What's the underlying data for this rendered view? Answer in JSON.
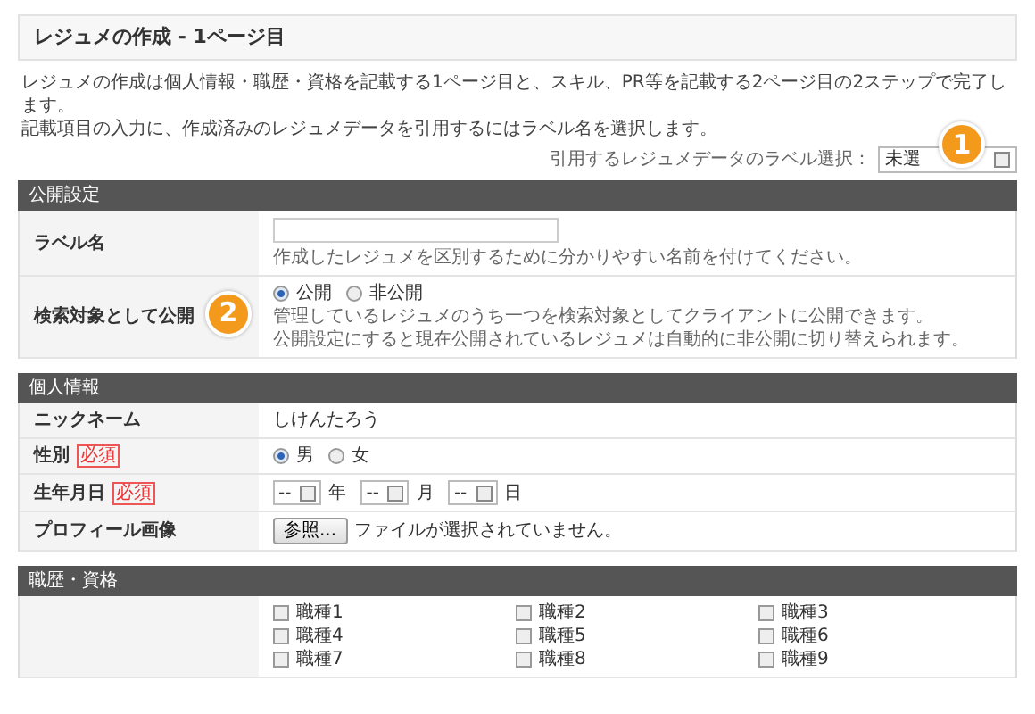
{
  "page_title": "レジュメの作成 - 1ページ目",
  "intro": [
    "レジュメの作成は個人情報・職歴・資格を記載する1ページ目と、スキル、PR等を記載する2ページ目の2ステップで完了します。",
    "記載項目の入力に、作成済みのレジュメデータを引用するにはラベル名を選択します。"
  ],
  "label_select": {
    "label": "引用するレジュメデータのラベル選択：",
    "value": "未選",
    "callout": "1"
  },
  "sections": [
    {
      "title": "公開設定",
      "rows": [
        {
          "kind": "text_input",
          "label": "ラベル名",
          "hint": "作成したレジュメを区別するために分かりやすい名前を付けてください。"
        },
        {
          "kind": "radio",
          "label": "検索対象として公開",
          "callout": "2",
          "options": [
            {
              "label": "公開",
              "selected": true
            },
            {
              "label": "非公開",
              "selected": false
            }
          ],
          "notes": [
            "管理しているレジュメのうち一つを検索対象としてクライアントに公開できます。",
            "公開設定にすると現在公開されているレジュメは自動的に非公開に切り替えられます。"
          ]
        }
      ]
    },
    {
      "title": "個人情報",
      "rows": [
        {
          "kind": "text",
          "label": "ニックネーム",
          "value": "しけんたろう"
        },
        {
          "kind": "radio",
          "label": "性別",
          "required_label": "必須",
          "options": [
            {
              "label": "男",
              "selected": true
            },
            {
              "label": "女",
              "selected": false
            }
          ]
        },
        {
          "kind": "date",
          "label": "生年月日",
          "required_label": "必須",
          "parts": [
            {
              "value": "--",
              "unit": "年"
            },
            {
              "value": "--",
              "unit": "月"
            },
            {
              "value": "--",
              "unit": "日"
            }
          ]
        },
        {
          "kind": "file",
          "label": "プロフィール画像",
          "button": "参照...",
          "status": "ファイルが選択されていません。"
        }
      ]
    },
    {
      "title": "職歴・資格",
      "rows": [
        {
          "kind": "checkboxes",
          "items": [
            {
              "label": "職種1",
              "checked": false
            },
            {
              "label": "職種2",
              "checked": false
            },
            {
              "label": "職種3",
              "checked": false
            },
            {
              "label": "職種4",
              "checked": false
            },
            {
              "label": "職種5",
              "checked": false
            },
            {
              "label": "職種6",
              "checked": false
            },
            {
              "label": "職種7",
              "checked": false
            },
            {
              "label": "職種8",
              "checked": false
            },
            {
              "label": "職種9",
              "checked": false
            }
          ]
        }
      ]
    }
  ]
}
